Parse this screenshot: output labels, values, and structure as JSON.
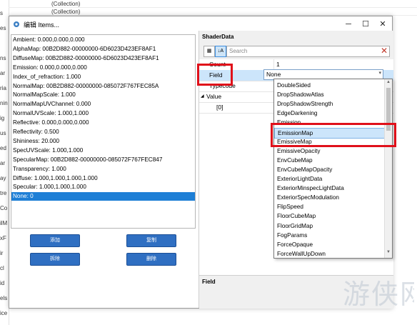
{
  "background": {
    "left_fragments": [
      "s",
      "es",
      "",
      "ns",
      "ar",
      "ria",
      "nin",
      "ig",
      "us",
      "ed",
      "ar",
      "ay",
      "tre",
      "Co",
      "ilM",
      "xF",
      "ir",
      "cl",
      "id",
      "els",
      "ice"
    ],
    "top_rows": [
      "(Collection)",
      "(Collection)"
    ]
  },
  "dialog": {
    "title": "编辑 Items...",
    "controls": {
      "minimize": "─",
      "maximize": "☐",
      "close": "✕"
    }
  },
  "items": [
    "Ambient:  0.000,0.000,0.000",
    "AlphaMap:  00B2D882-00000000-6D6023D423EF8AF1",
    "DiffuseMap:  00B2D882-00000000-6D6023D423EF8AF1",
    "Emission:  0.000,0.000,0.000",
    "Index_of_refraction:  1.000",
    "NormalMap:  00B2D882-00000000-085072F767FEC85A",
    "NormalMapScale:  1.000",
    "NormalMapUVChannel:  0.000",
    "NormalUVScale:  1.000,1.000",
    "Reflective:  0.000,0.000,0.000",
    "Reflectivity:  0.500",
    "Shininess:  20.000",
    "SpecUVScale:  1.000,1.000",
    "SpecularMap:  00B2D882-00000000-085072F767FEC847",
    "Transparency:  1.000",
    "Diffuse:  1.000,1.000,1.000,1.000",
    "Specular:  1.000,1.000,1.000",
    "None:  0"
  ],
  "selected_item_index": 17,
  "buttons": {
    "add": "添加",
    "modify": "复制",
    "copy": "拆除",
    "delete": "删除"
  },
  "property_grid": {
    "header": "ShaderData",
    "search_placeholder": "Search",
    "rows": [
      {
        "key": "Count",
        "value": "1"
      },
      {
        "key": "Field",
        "value": "None"
      },
      {
        "key": "Typecode",
        "value": ""
      },
      {
        "key": "Value",
        "value": "",
        "expander": "◢"
      },
      {
        "key": "[0]",
        "value": ""
      }
    ],
    "footer_label": "Field"
  },
  "dropdown": {
    "options": [
      "DoubleSided",
      "DropShadowAtlas",
      "DropShadowStrength",
      "EdgeDarkening",
      "Emission",
      "EmissionMap",
      "EmissiveMap",
      "EmissiveOpacity",
      "EnvCubeMap",
      "EnvCubeMapOpacity",
      "ExteriorLightData",
      "ExteriorMinspecLightData",
      "ExteriorSpecModulation",
      "FlipSpeed",
      "FloorCubeMap",
      "FloorGridMap",
      "FogParams",
      "ForceOpaque",
      "ForceWallUpDown"
    ],
    "highlighted": "EmissionMap"
  },
  "watermark": "游侠网",
  "colors": {
    "accent": "#1e7fd6",
    "annotation": "#e0101a",
    "button": "#2f6fc2"
  }
}
